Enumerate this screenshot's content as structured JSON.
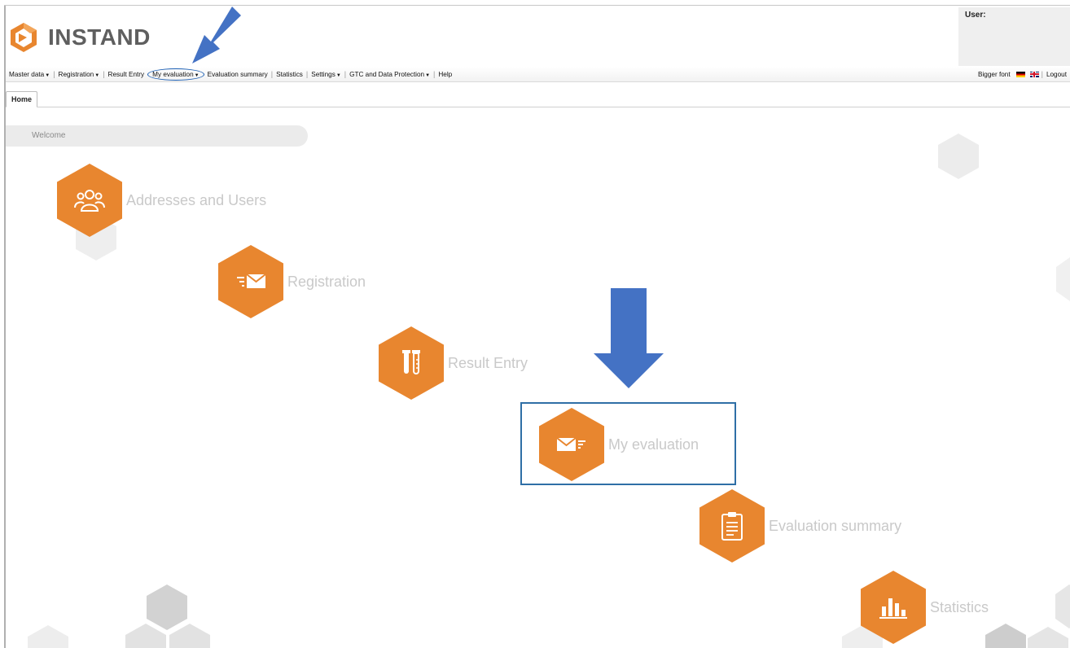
{
  "brand": {
    "logo_text": "INSTAND",
    "accent_color": "#e8862f",
    "annotation_color": "#4472c4"
  },
  "user_panel": {
    "label": "User:"
  },
  "menu": {
    "items": [
      {
        "label": "Master data",
        "dropdown": true
      },
      {
        "label": "Registration",
        "dropdown": true
      },
      {
        "label": "Result Entry",
        "dropdown": false
      },
      {
        "label": "My evaluation",
        "dropdown": true,
        "circled": true
      },
      {
        "label": "Evaluation summary",
        "dropdown": false
      },
      {
        "label": "Statistics",
        "dropdown": false
      },
      {
        "label": "Settings",
        "dropdown": true
      },
      {
        "label": "GTC and Data Protection",
        "dropdown": true
      },
      {
        "label": "Help",
        "dropdown": false
      }
    ],
    "right": {
      "bigger_font": "Bigger font",
      "flags": [
        "flag-germany-icon",
        "flag-uk-icon"
      ],
      "logout": "Logout"
    }
  },
  "tabs": [
    {
      "label": "Home",
      "active": true
    }
  ],
  "welcome": {
    "text": "Welcome"
  },
  "tiles": [
    {
      "label": "Addresses and Users",
      "icon": "users-icon"
    },
    {
      "label": "Registration",
      "icon": "send-mail-icon"
    },
    {
      "label": "Result Entry",
      "icon": "test-tubes-icon"
    },
    {
      "label": "My evaluation",
      "icon": "mail-list-icon",
      "highlighted": true
    },
    {
      "label": "Evaluation summary",
      "icon": "clipboard-icon"
    },
    {
      "label": "Statistics",
      "icon": "bar-chart-icon"
    }
  ]
}
